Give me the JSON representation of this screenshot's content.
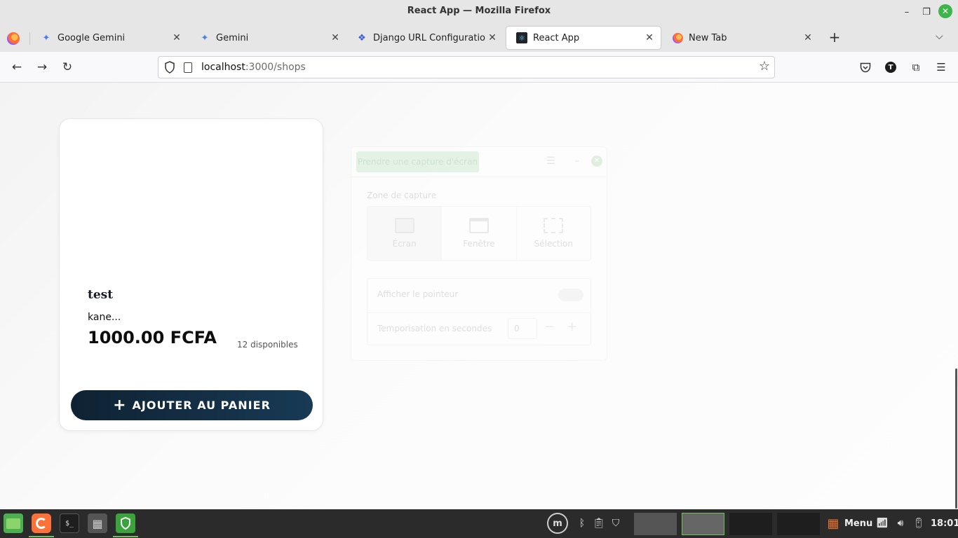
{
  "window": {
    "title": "React App — Mozilla Firefox"
  },
  "tabs": [
    {
      "label": "Google Gemini",
      "icon": "gemini-star-icon"
    },
    {
      "label": "Gemini",
      "icon": "gemini-star-icon"
    },
    {
      "label": "Django URL Configuration f",
      "icon": "django-icon"
    },
    {
      "label": "React App",
      "icon": "react-icon",
      "active": true
    },
    {
      "label": "New Tab",
      "icon": "firefox-icon"
    }
  ],
  "urlbar": {
    "host": "localhost",
    "path": ":3000/shops"
  },
  "product": {
    "name": "test",
    "description": "kane...",
    "price": "1000.00 FCFA",
    "stock": "12 disponibles",
    "add_button": "AJOUTER AU PANIER"
  },
  "screenshot_dialog": {
    "take_button": "Prendre une capture d'écran",
    "zone_label": "Zone de capture",
    "modes": [
      "Écran",
      "Fenêtre",
      "Sélection"
    ],
    "show_pointer": "Afficher le pointeur",
    "delay_label": "Temporisation en secondes",
    "delay_value": "0"
  },
  "taskbar": {
    "menu_label": "Menu",
    "clock": "18:01"
  },
  "colors": {
    "accent": "#3cb54a",
    "button_dark": "#0f2233"
  }
}
